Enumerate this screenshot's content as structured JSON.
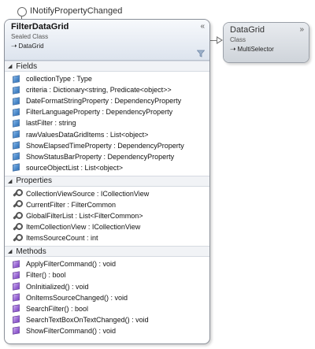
{
  "interface_label": "INotifyPropertyChanged",
  "main_class": {
    "title": "FilterDataGrid",
    "stereotype": "Sealed Class",
    "base": "DataGrid",
    "collapse_glyph": "«"
  },
  "base_class": {
    "title": "DataGrid",
    "stereotype": "Class",
    "base": "MultiSelector",
    "collapse_glyph": "»"
  },
  "sections": {
    "fields": {
      "label": "Fields",
      "items": [
        "collectionType : Type",
        "criteria : Dictionary<string, Predicate<object>>",
        "DateFormatStringProperty : DependencyProperty",
        "FilterLanguageProperty : DependencyProperty",
        "lastFilter : string",
        "rawValuesDataGridItems : List<object>",
        "ShowElapsedTimeProperty : DependencyProperty",
        "ShowStatusBarProperty : DependencyProperty",
        "sourceObjectList : List<object>"
      ]
    },
    "properties": {
      "label": "Properties",
      "items": [
        "CollectionViewSource : ICollectionView",
        "CurrentFilter : FilterCommon",
        "GlobalFilterList : List<FilterCommon>",
        "ItemCollectionView : ICollectionView",
        "ItemsSourceCount : int"
      ]
    },
    "methods": {
      "label": "Methods",
      "items": [
        "ApplyFilterCommand() : void",
        "Filter() : bool",
        "OnInitialized() : void",
        "OnItemsSourceChanged() : void",
        "SearchFilter() : bool",
        "SearchTextBoxOnTextChanged() : void",
        "ShowFilterCommand() : void"
      ]
    }
  },
  "icons": {
    "field": "field-icon",
    "property": "property-icon",
    "method": "method-icon",
    "section_toggle": "triangle-down-icon",
    "filter": "funnel-icon",
    "inherits": "inherits-arrow-icon"
  }
}
